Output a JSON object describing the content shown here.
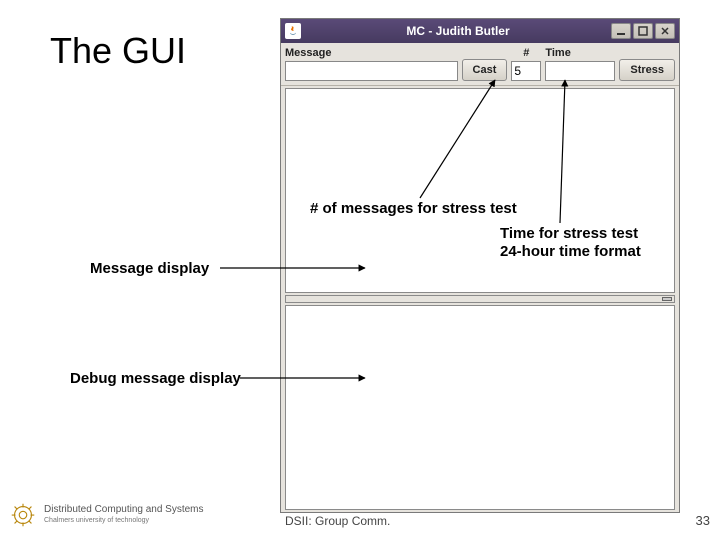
{
  "slide_title": "The GUI",
  "window": {
    "title": "MC - Judith Butler",
    "labels": {
      "message": "Message",
      "num": "#",
      "time": "Time"
    },
    "inputs": {
      "message_value": "",
      "num_value": "5",
      "time_value": ""
    },
    "buttons": {
      "cast": "Cast",
      "stress": "Stress"
    }
  },
  "annotations": {
    "count": "# of messages for stress test",
    "time_line1": "Time for stress test",
    "time_line2": "24-hour time format",
    "msg_pane": "Message display",
    "dbg_pane": "Debug message display"
  },
  "footer": {
    "org_line1": "Distributed Computing and Systems",
    "org_line2": "Chalmers university of technology",
    "center": "DSII: Group Comm.",
    "page": "33"
  }
}
